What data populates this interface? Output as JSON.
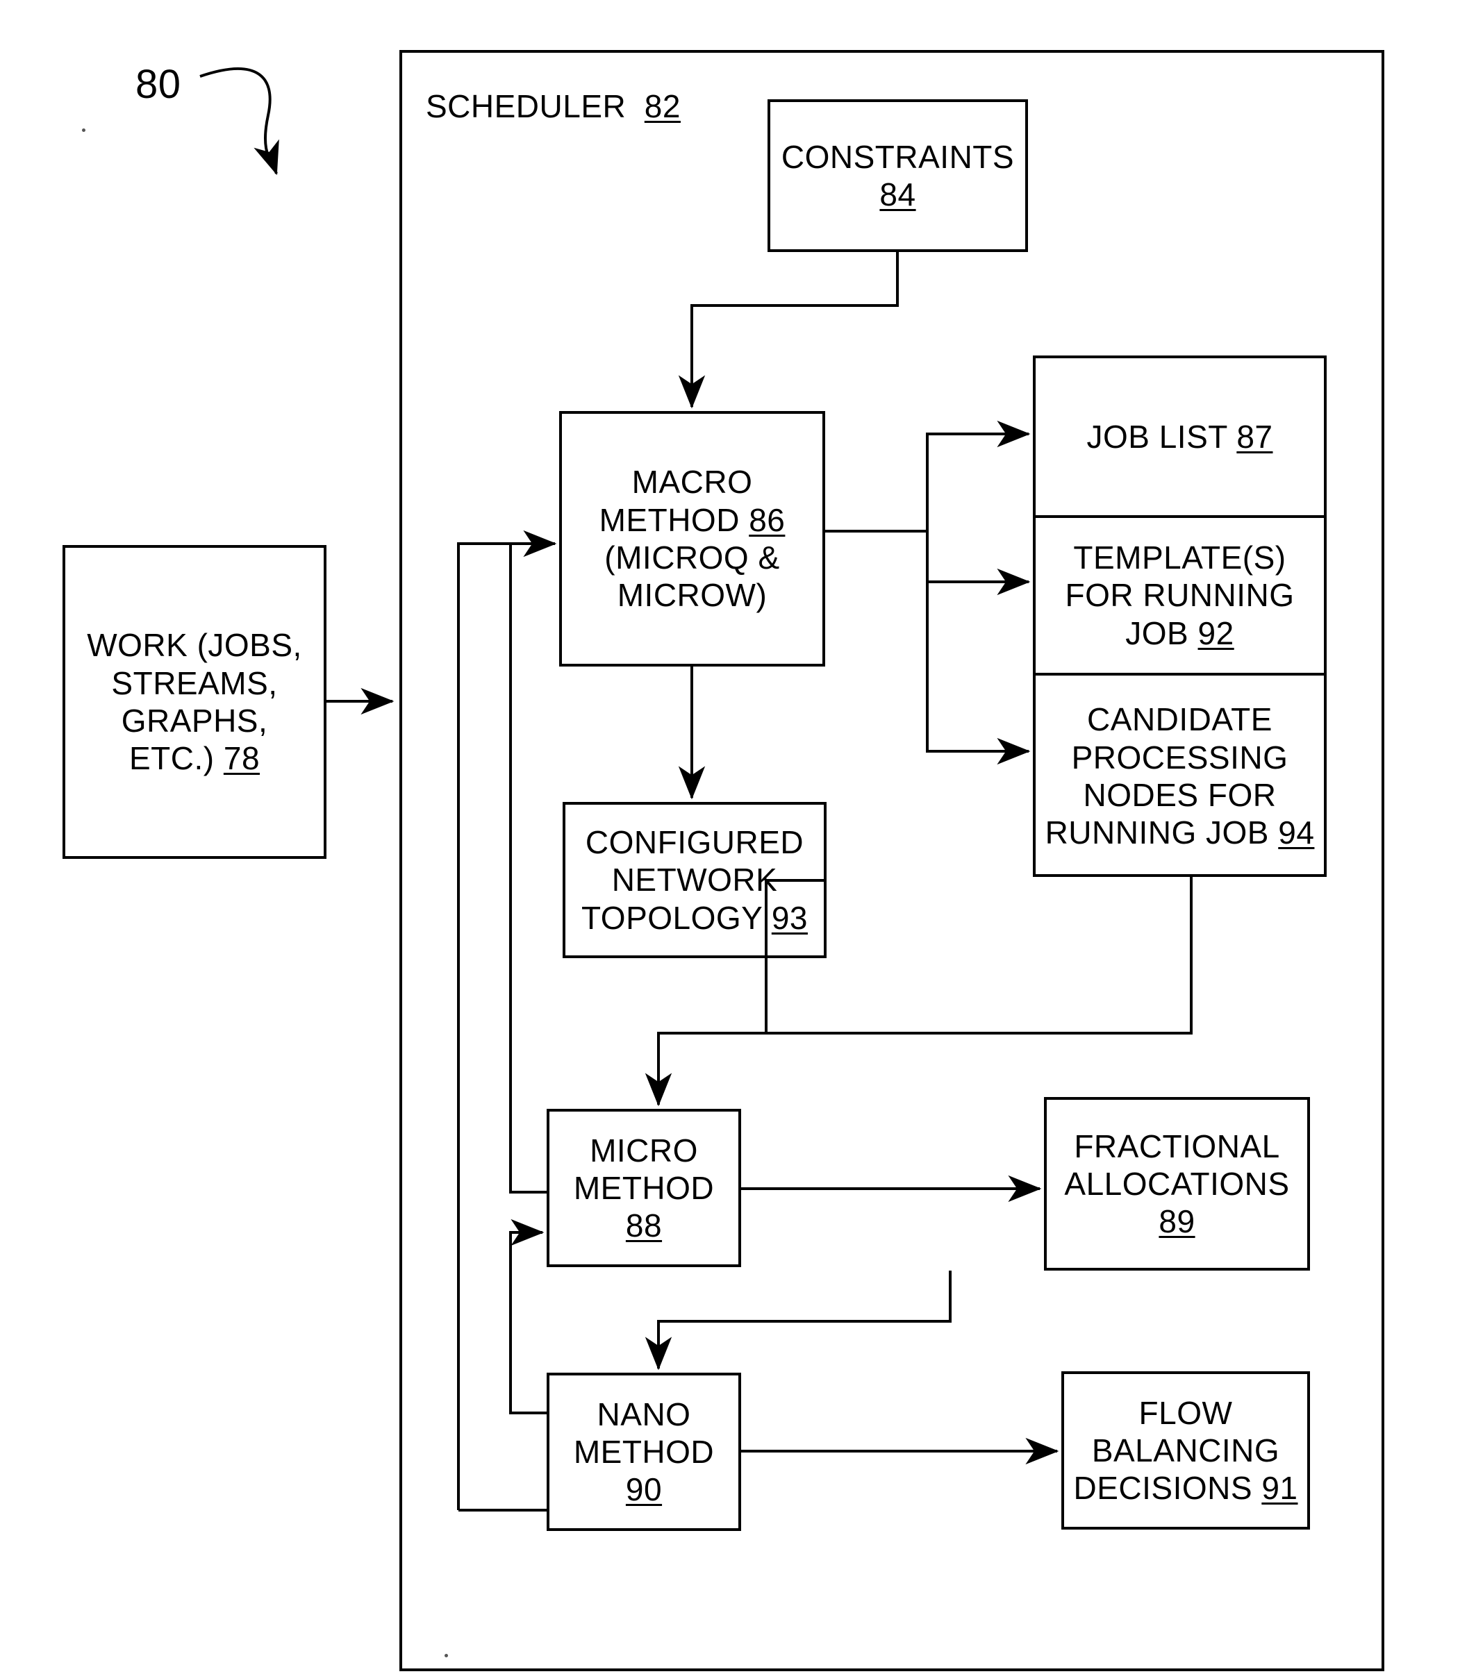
{
  "figure": {
    "ref_label": "80"
  },
  "scheduler": {
    "title": "SCHEDULER",
    "ref": "82"
  },
  "boxes": {
    "constraints": {
      "text": "CONSTRAINTS",
      "ref": "84"
    },
    "work": {
      "text": "WORK (JOBS,\nSTREAMS,\nGRAPHS,\nETC.)",
      "ref": "78"
    },
    "macro": {
      "text": "MACRO\nMETHOD",
      "ref": "86",
      "text_after": "\n(MICROQ &\nMICROW)"
    },
    "job_list": {
      "text": "JOB LIST",
      "ref": "87"
    },
    "templates": {
      "text": "TEMPLATE(S)\nFOR RUNNING\nJOB",
      "ref": "92"
    },
    "candidates": {
      "text": "CANDIDATE\nPROCESSING\nNODES FOR\nRUNNING JOB",
      "ref": "94"
    },
    "topology": {
      "text": "CONFIGURED\nNETWORK\nTOPOLOGY",
      "ref": "93"
    },
    "micro": {
      "text": "MICRO\nMETHOD",
      "ref": "88"
    },
    "fractional": {
      "text": "FRACTIONAL\nALLOCATIONS",
      "ref": "89"
    },
    "nano": {
      "text": "NANO\nMETHOD",
      "ref": "90"
    },
    "flow": {
      "text": "FLOW\nBALANCING\nDECISIONS",
      "ref": "91"
    }
  },
  "colors": {
    "ink": "#000000",
    "paper": "#ffffff"
  }
}
